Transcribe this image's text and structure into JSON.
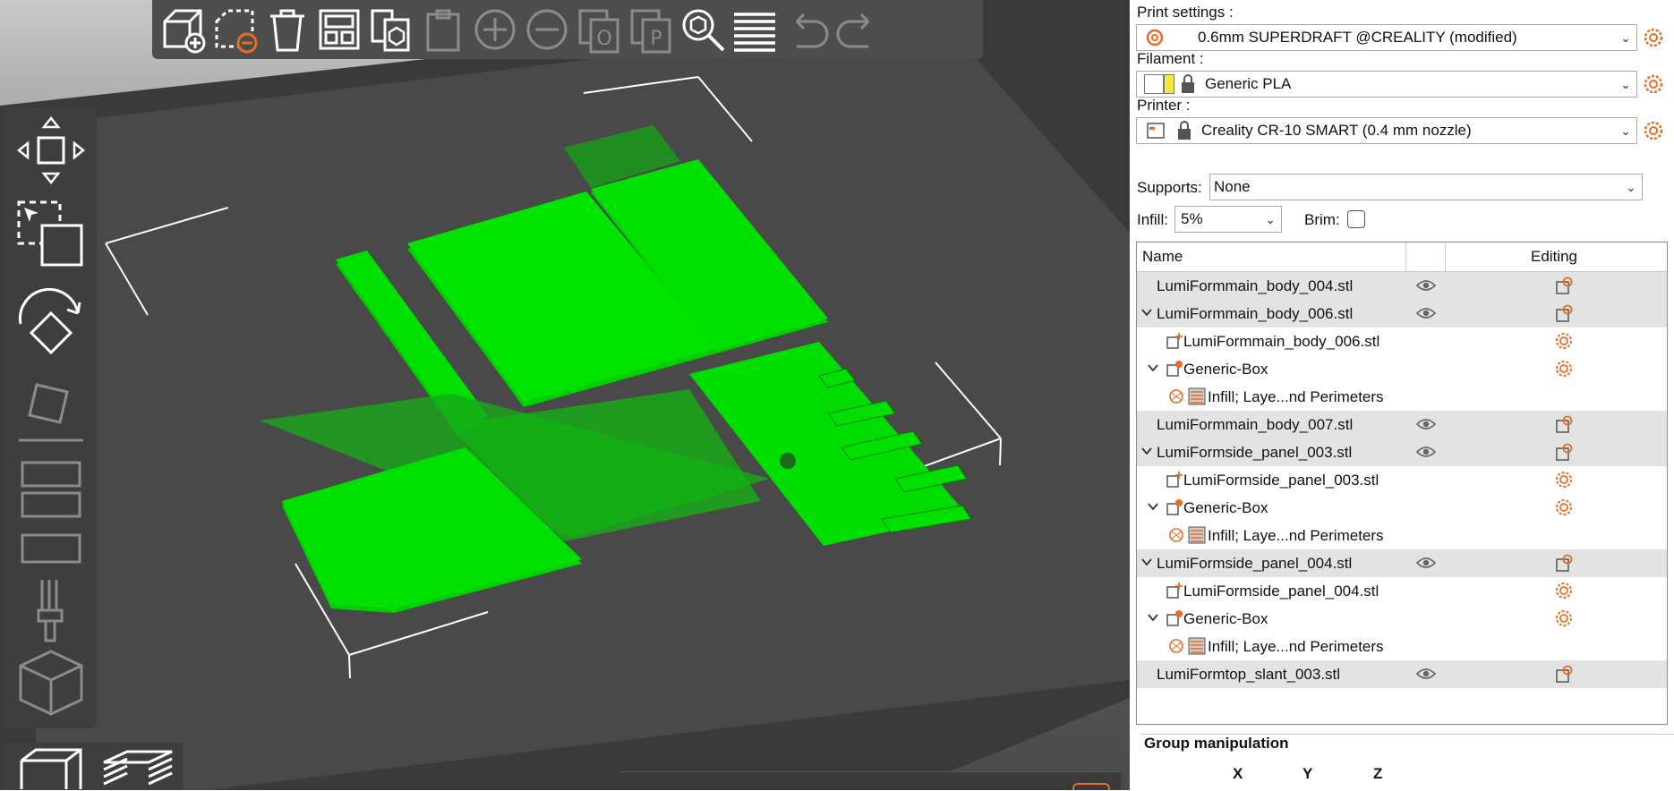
{
  "toolbar": {
    "buttons": [
      {
        "name": "add-button",
        "icon": "add-icon",
        "enabled": true
      },
      {
        "name": "delete-button",
        "icon": "delete-icon",
        "enabled": true
      },
      {
        "name": "delete-all-button",
        "icon": "trash-icon",
        "enabled": true
      },
      {
        "name": "arrange-button",
        "icon": "arrange-icon",
        "enabled": true
      },
      {
        "name": "copy-button",
        "icon": "copy-icon",
        "enabled": true
      },
      {
        "name": "paste-button",
        "icon": "paste-icon",
        "enabled": false
      },
      {
        "name": "add-instance-button",
        "icon": "plus-icon",
        "enabled": false
      },
      {
        "name": "remove-instance-button",
        "icon": "minus-icon",
        "enabled": false
      },
      {
        "name": "split-objects-button",
        "icon": "split-objects-icon",
        "enabled": false
      },
      {
        "name": "split-parts-button",
        "icon": "split-parts-icon",
        "enabled": false
      },
      {
        "name": "search-button",
        "icon": "search-icon",
        "enabled": true
      },
      {
        "name": "layers-editing-button",
        "icon": "layers-icon",
        "enabled": true
      },
      {
        "name": "undo-button",
        "icon": "undo-icon",
        "enabled": false
      },
      {
        "name": "redo-button",
        "icon": "redo-icon",
        "enabled": false
      }
    ]
  },
  "left_tools": [
    {
      "name": "move-tool",
      "icon": "move-icon",
      "enabled": true
    },
    {
      "name": "select-tool",
      "icon": "select-icon",
      "enabled": true
    },
    {
      "name": "rotate-tool",
      "icon": "rotate-icon",
      "enabled": true
    },
    {
      "name": "place-on-face-tool",
      "icon": "place-on-face-icon",
      "enabled": false
    },
    {
      "name": "cut-tool",
      "icon": "cut-icon",
      "enabled": false
    },
    {
      "name": "hollow-tool",
      "icon": "hollow-icon",
      "enabled": false
    },
    {
      "name": "paint-tool",
      "icon": "paint-icon",
      "enabled": false
    },
    {
      "name": "seam-tool",
      "icon": "seam-icon",
      "enabled": false
    }
  ],
  "view_buttons": [
    {
      "name": "view-3d-button",
      "icon": "cube-view-icon"
    },
    {
      "name": "view-preview-button",
      "icon": "layers-preview-icon"
    }
  ],
  "sidebar": {
    "print_settings": {
      "label": "Print settings :",
      "value": "0.6mm SUPERDRAFT @CREALITY (modified)"
    },
    "filament": {
      "label": "Filament :",
      "value": "Generic PLA",
      "color": "#f5e642"
    },
    "printer": {
      "label": "Printer :",
      "value": "Creality CR-10 SMART (0.4 mm nozzle)"
    },
    "supports": {
      "label": "Supports:",
      "value": "None"
    },
    "infill": {
      "label": "Infill:",
      "value": "5%"
    },
    "brim": {
      "label": "Brim:",
      "checked": false
    },
    "tree": {
      "headers": {
        "name": "Name",
        "editing": "Editing"
      },
      "rows": [
        {
          "level": 0,
          "expander": "",
          "icon": "",
          "name": "LumiFormmain_body_004.stl",
          "eye": true,
          "edit": "object-edit-icon",
          "shaded": true
        },
        {
          "level": 0,
          "expander": "chevron-down-icon",
          "icon": "",
          "name": "LumiFormmain_body_006.stl",
          "eye": true,
          "edit": "object-edit-icon",
          "shaded": true
        },
        {
          "level": 1,
          "expander": "",
          "icon": "part-icon",
          "name": "LumiFormmain_body_006.stl",
          "eye": false,
          "edit": "gear-icon",
          "shaded": false
        },
        {
          "level": 1,
          "expander": "chevron-down-icon",
          "icon": "modifier-icon",
          "name": "Generic-Box",
          "eye": false,
          "edit": "gear-icon",
          "shaded": false
        },
        {
          "level": 2,
          "expander": "",
          "icon": "settings-icon",
          "name": "Infill; Laye...nd Perimeters",
          "eye": false,
          "edit": "",
          "shaded": false
        },
        {
          "level": 0,
          "expander": "",
          "icon": "",
          "name": "LumiFormmain_body_007.stl",
          "eye": true,
          "edit": "object-edit-icon",
          "shaded": true
        },
        {
          "level": 0,
          "expander": "chevron-down-icon",
          "icon": "",
          "name": "LumiFormside_panel_003.stl",
          "eye": true,
          "edit": "object-edit-icon",
          "shaded": true
        },
        {
          "level": 1,
          "expander": "",
          "icon": "part-icon",
          "name": "LumiFormside_panel_003.stl",
          "eye": false,
          "edit": "gear-icon",
          "shaded": false
        },
        {
          "level": 1,
          "expander": "chevron-down-icon",
          "icon": "modifier-icon",
          "name": "Generic-Box",
          "eye": false,
          "edit": "gear-icon",
          "shaded": false
        },
        {
          "level": 2,
          "expander": "",
          "icon": "settings-icon",
          "name": "Infill; Laye...nd Perimeters",
          "eye": false,
          "edit": "",
          "shaded": false
        },
        {
          "level": 0,
          "expander": "chevron-down-icon",
          "icon": "",
          "name": "LumiFormside_panel_004.stl",
          "eye": true,
          "edit": "object-edit-icon",
          "shaded": true
        },
        {
          "level": 1,
          "expander": "",
          "icon": "part-icon",
          "name": "LumiFormside_panel_004.stl",
          "eye": false,
          "edit": "gear-icon",
          "shaded": false
        },
        {
          "level": 1,
          "expander": "chevron-down-icon",
          "icon": "modifier-icon",
          "name": "Generic-Box",
          "eye": false,
          "edit": "gear-icon",
          "shaded": false
        },
        {
          "level": 2,
          "expander": "",
          "icon": "settings-icon",
          "name": "Infill; Laye...nd Perimeters",
          "eye": false,
          "edit": "",
          "shaded": false
        },
        {
          "level": 0,
          "expander": "",
          "icon": "",
          "name": "LumiFormtop_slant_003.stl",
          "eye": true,
          "edit": "object-edit-icon",
          "shaded": true
        }
      ]
    },
    "group": {
      "title": "Group manipulation",
      "axes": [
        "X",
        "Y",
        "Z"
      ]
    }
  },
  "colors": {
    "accent": "#e86d24",
    "model": "#00e000",
    "bed": "#3c3c3c"
  }
}
